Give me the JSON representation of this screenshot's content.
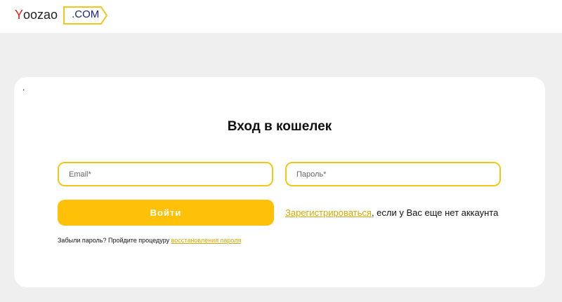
{
  "header": {
    "logo_letter": "Y",
    "logo_rest": "oozao",
    "logo_domain": ".COM"
  },
  "card": {
    "dot": ".",
    "title": "Вход в кошелек",
    "email_placeholder": "Email*",
    "password_placeholder": "Пароль*",
    "login_label": "Войти",
    "register_link": "Зарегистрироваться",
    "register_suffix": ", если у Вас еще нет аккаунта",
    "forgot_prefix": "Забыли пароль? Пройдите процедуру ",
    "forgot_link": "восстановления пароля"
  },
  "colors": {
    "accent": "#ffc107",
    "field_border": "#f2c71c",
    "link": "#d4a800",
    "logo_y": "#e02020",
    "logo_domain_text": "#1a237e",
    "page_bg": "#efefef"
  }
}
